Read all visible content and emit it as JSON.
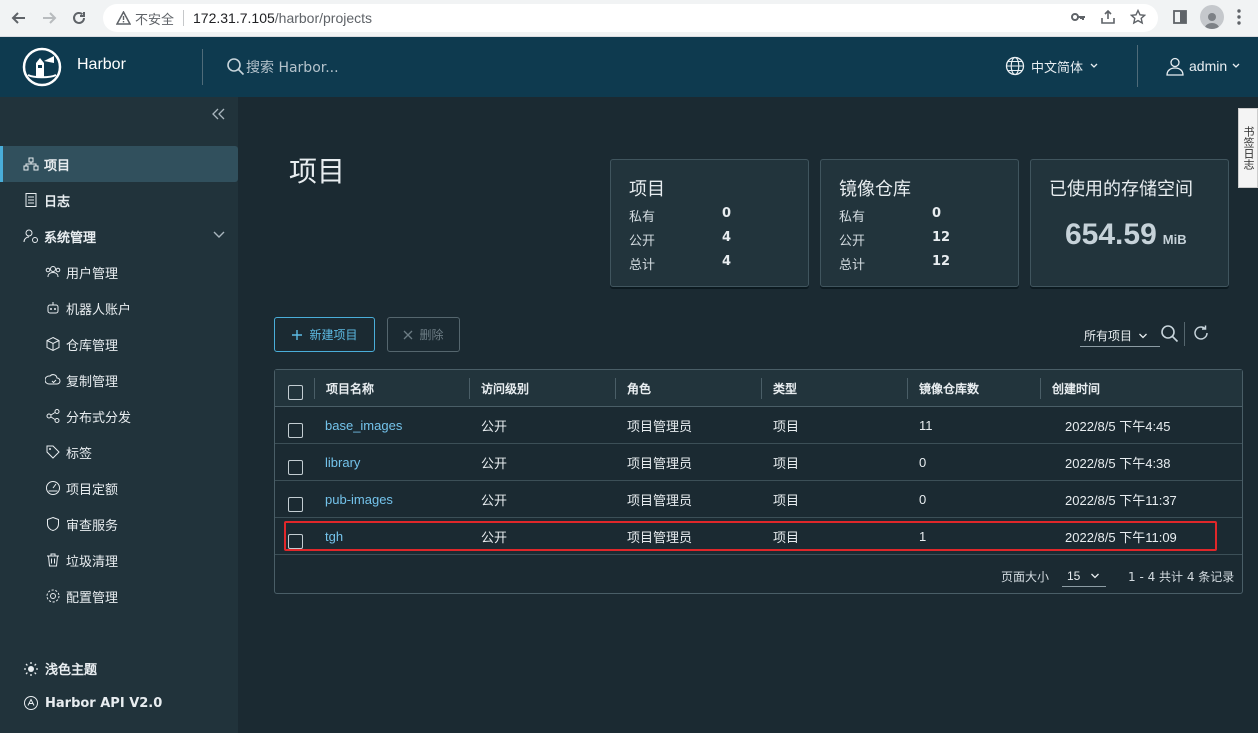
{
  "browser": {
    "insecure_label": "不安全",
    "url_host": "172.31.7.105",
    "url_path": "/harbor/projects"
  },
  "header": {
    "brand": "Harbor",
    "search_placeholder": "搜索 Harbor...",
    "language": "中文简体",
    "user": "admin"
  },
  "sidebar": {
    "items": [
      {
        "label": "项目",
        "icon": "projects-icon",
        "active": true
      },
      {
        "label": "日志",
        "icon": "logs-icon"
      },
      {
        "label": "系统管理",
        "icon": "admin-icon",
        "expanded": true
      }
    ],
    "sub_items": [
      {
        "label": "用户管理",
        "icon": "users-icon"
      },
      {
        "label": "机器人账户",
        "icon": "robot-icon"
      },
      {
        "label": "仓库管理",
        "icon": "registry-icon"
      },
      {
        "label": "复制管理",
        "icon": "replication-icon"
      },
      {
        "label": "分布式分发",
        "icon": "share-icon"
      },
      {
        "label": "标签",
        "icon": "tag-icon"
      },
      {
        "label": "项目定额",
        "icon": "quota-icon"
      },
      {
        "label": "审查服务",
        "icon": "shield-icon"
      },
      {
        "label": "垃圾清理",
        "icon": "trash-icon"
      },
      {
        "label": "配置管理",
        "icon": "gear-icon"
      }
    ],
    "theme": "浅色主题",
    "api": "Harbor API V2.0"
  },
  "edge_tab": "书签日志",
  "page": {
    "title": "项目"
  },
  "cards": {
    "projects": {
      "title": "项目",
      "rows": [
        {
          "label": "私有",
          "value": "0"
        },
        {
          "label": "公开",
          "value": "4"
        },
        {
          "label": "总计",
          "value": "4"
        }
      ]
    },
    "repos": {
      "title": "镜像仓库",
      "rows": [
        {
          "label": "私有",
          "value": "0"
        },
        {
          "label": "公开",
          "value": "12"
        },
        {
          "label": "总计",
          "value": "12"
        }
      ]
    },
    "storage": {
      "title": "已使用的存储空间",
      "value": "654.59",
      "unit": "MiB"
    }
  },
  "toolbar": {
    "new_project": "新建项目",
    "delete": "删除",
    "filter": "所有项目"
  },
  "table": {
    "columns": [
      "项目名称",
      "访问级别",
      "角色",
      "类型",
      "镜像仓库数",
      "创建时间"
    ],
    "rows": [
      {
        "name": "base_images",
        "access": "公开",
        "role": "项目管理员",
        "type": "项目",
        "repos": "11",
        "created": "2022/8/5 下午4:45"
      },
      {
        "name": "library",
        "access": "公开",
        "role": "项目管理员",
        "type": "项目",
        "repos": "0",
        "created": "2022/8/5 下午4:38"
      },
      {
        "name": "pub-images",
        "access": "公开",
        "role": "项目管理员",
        "type": "项目",
        "repos": "0",
        "created": "2022/8/5 下午11:37"
      },
      {
        "name": "tgh",
        "access": "公开",
        "role": "项目管理员",
        "type": "项目",
        "repos": "1",
        "created": "2022/8/5 下午11:09"
      }
    ],
    "page_size_label": "页面大小",
    "page_size": "15",
    "count": "1 - 4 共计 4 条记录"
  },
  "colors": {
    "header_bg": "#0e3a4f",
    "sidebar_bg": "#21333b",
    "main_bg": "#1b2a32",
    "accent": "#49aeda",
    "highlight": "#e0272a"
  }
}
